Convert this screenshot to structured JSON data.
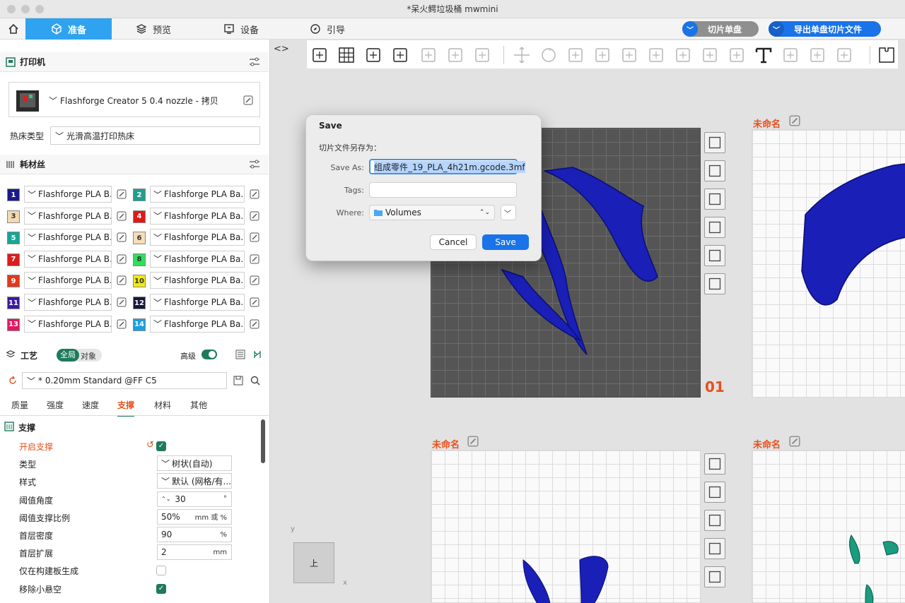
{
  "window": {
    "title": "*呆火鳄垃圾桶 mwmini"
  },
  "tabs": [
    {
      "label": "准备",
      "icon": "prepare-icon"
    },
    {
      "label": "预览",
      "icon": "layers-icon"
    },
    {
      "label": "设备",
      "icon": "device-icon"
    },
    {
      "label": "引导",
      "icon": "compass-icon"
    }
  ],
  "actions": {
    "slice_plate": "切片单盘",
    "export_plate": "导出单盘切片文件"
  },
  "printer": {
    "section_title": "打印机",
    "name": "Flashforge Creator 5 0.4 nozzle - 拷贝",
    "bed_label": "热床类型",
    "bed_value": "光滑高温打印热床"
  },
  "filament": {
    "section_title": "耗材丝",
    "items": [
      {
        "num": "1",
        "color": "#1a1a8c",
        "label": "Flashforge PLA B..."
      },
      {
        "num": "2",
        "color": "#1e9e8e",
        "label": "Flashforge PLA Ba..."
      },
      {
        "num": "3",
        "color": "#f2d9b0",
        "label": "Flashforge PLA B..."
      },
      {
        "num": "4",
        "color": "#e01818",
        "label": "Flashforge PLA Ba..."
      },
      {
        "num": "5",
        "color": "#19a595",
        "label": "Flashforge PLA B..."
      },
      {
        "num": "6",
        "color": "#f5deb8",
        "label": "Flashforge PLA Ba..."
      },
      {
        "num": "7",
        "color": "#dd1c1c",
        "label": "Flashforge PLA B..."
      },
      {
        "num": "8",
        "color": "#2ee05a",
        "label": "Flashforge PLA Ba..."
      },
      {
        "num": "9",
        "color": "#e2381c",
        "label": "Flashforge PLA B..."
      },
      {
        "num": "10",
        "color": "#f2ea10",
        "label": "Flashforge PLA Ba..."
      },
      {
        "num": "11",
        "color": "#3a1ba0",
        "label": "Flashforge PLA B..."
      },
      {
        "num": "12",
        "color": "#15173a",
        "label": "Flashforge PLA Ba..."
      },
      {
        "num": "13",
        "color": "#e21860",
        "label": "Flashforge PLA B..."
      },
      {
        "num": "14",
        "color": "#1aa0e0",
        "label": "Flashforge PLA Ba..."
      }
    ]
  },
  "process": {
    "section_title": "工艺",
    "toggle_global": "全局",
    "toggle_object": "对象",
    "advanced_label": "高级",
    "preset": "* 0.20mm Standard @FF C5",
    "subtabs": [
      "质量",
      "强度",
      "速度",
      "支撑",
      "材料",
      "其他"
    ],
    "active_subtab": "支撑"
  },
  "support": {
    "group_title": "支撑",
    "rows": [
      {
        "label": "开启支撑",
        "value": "",
        "unit": "",
        "type": "checkbox",
        "checked": true
      },
      {
        "label": "类型",
        "value": "树状(自动)",
        "unit": "",
        "type": "select"
      },
      {
        "label": "样式",
        "value": "默认 (网格/有...",
        "unit": "",
        "type": "select"
      },
      {
        "label": "阈值角度",
        "value": "30",
        "unit": "°",
        "type": "spin"
      },
      {
        "label": "阈值支撑比例",
        "value": "50%",
        "unit": "mm 或 %",
        "type": "input"
      },
      {
        "label": "首层密度",
        "value": "90",
        "unit": "%",
        "type": "input"
      },
      {
        "label": "首层扩展",
        "value": "2",
        "unit": "mm",
        "type": "input"
      },
      {
        "label": "仅在构建板生成",
        "value": "",
        "unit": "",
        "type": "checkbox",
        "checked": false
      },
      {
        "label": "移除小悬空",
        "value": "",
        "unit": "",
        "type": "checkbox",
        "checked": true
      }
    ]
  },
  "plates": {
    "unnamed": "未命名",
    "number": "01"
  },
  "gizmo": {
    "face": "上",
    "x": "x",
    "y": "y"
  },
  "dialog": {
    "title": "Save",
    "subtitle": "切片文件另存为：",
    "save_as_label": "Save As:",
    "save_as_value": "组成零件_19_PLA_4h21m.gcode.3mf",
    "tags_label": "Tags:",
    "tags_value": "",
    "where_label": "Where:",
    "where_value": "Volumes",
    "cancel": "Cancel",
    "save": "Save"
  },
  "colors": {
    "accent": "#2fa3f0",
    "blue_button": "#1a73e8",
    "green": "#1e7a5a",
    "plate_label": "#e8501c"
  }
}
